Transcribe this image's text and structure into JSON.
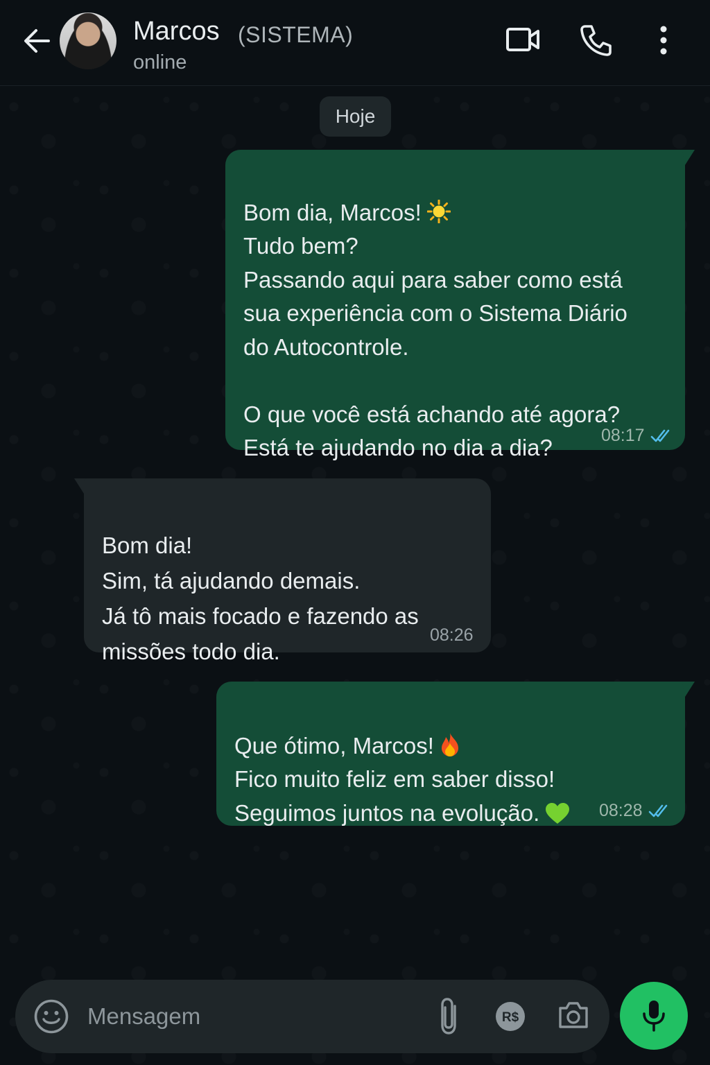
{
  "header": {
    "contact_name": "Marcos",
    "contact_tag": "(SISTEMA)",
    "status": "online",
    "icons": [
      "back-arrow-icon",
      "video-call-icon",
      "voice-call-icon",
      "more-options-icon"
    ]
  },
  "chat": {
    "date_label": "Hoje",
    "messages": [
      {
        "direction": "outgoing",
        "text_lines": [
          "Bom dia, Marcos!",
          "Tudo bem?\nPassando aqui para saber como está\nsua experiência com o Sistema Diário\ndo Autocontrole.\n\nO que você está achando até agora?\nEstá te ajudando no dia a dia?"
        ],
        "emoji": "sun-emoji",
        "time": "08:17",
        "status": "read"
      },
      {
        "direction": "incoming",
        "text": "Bom dia!\nSim, tá ajudando demais.\nJá tô mais focado e fazendo as\nmissões todo dia.",
        "time": "08:26"
      },
      {
        "direction": "outgoing",
        "text_lines": [
          "Que ótimo, Marcos!",
          "Fico muito feliz em saber disso!\nSeguimos juntos na evolução."
        ],
        "emojis": [
          "fire-emoji",
          "green-heart-emoji"
        ],
        "time": "08:28",
        "status": "read"
      }
    ]
  },
  "composer": {
    "placeholder": "Mensagem",
    "icons": [
      "emoji-icon",
      "attach-icon",
      "payment-icon",
      "camera-icon",
      "mic-icon"
    ]
  },
  "colors": {
    "background": "#0b1014",
    "outgoing_bubble": "#144d37",
    "incoming_bubble": "#1f2629",
    "read_ticks": "#53bdeb",
    "mic_button": "#21c063"
  }
}
